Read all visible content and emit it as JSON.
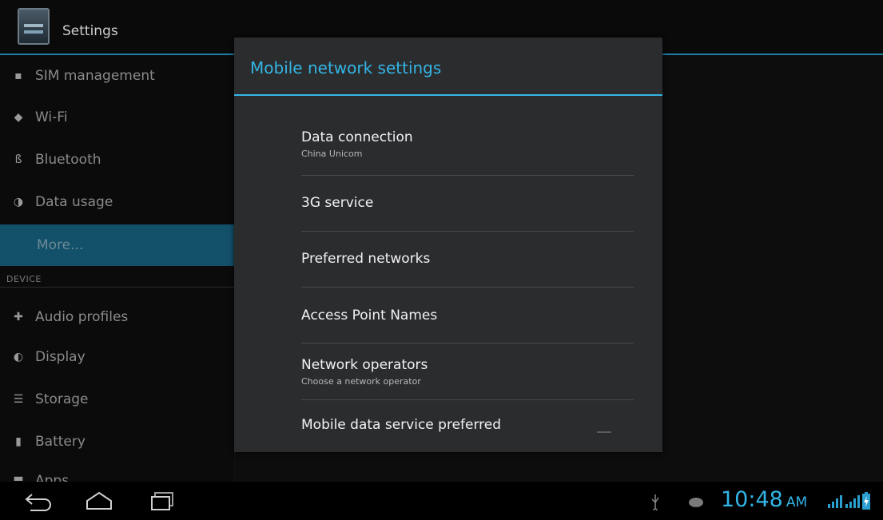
{
  "app": {
    "title": "Settings"
  },
  "sidebar": {
    "items": [
      {
        "label": "SIM management",
        "icon": "sim-icon"
      },
      {
        "label": "Wi-Fi",
        "icon": "wifi-icon"
      },
      {
        "label": "Bluetooth",
        "icon": "bluetooth-icon"
      },
      {
        "label": "Data usage",
        "icon": "data-usage-icon"
      },
      {
        "label": "More...",
        "icon": ""
      }
    ],
    "section_device": "DEVICE",
    "device_items": [
      {
        "label": "Audio profiles",
        "icon": "audio-profiles-icon"
      },
      {
        "label": "Display",
        "icon": "display-icon"
      },
      {
        "label": "Storage",
        "icon": "storage-icon"
      },
      {
        "label": "Battery",
        "icon": "battery-icon"
      },
      {
        "label": "Apps",
        "icon": "apps-icon"
      }
    ]
  },
  "dialog": {
    "title": "Mobile network settings",
    "items": [
      {
        "title": "Data connection",
        "summary": "China Unicom"
      },
      {
        "title": "3G service",
        "summary": ""
      },
      {
        "title": "Preferred networks",
        "summary": ""
      },
      {
        "title": "Access Point Names",
        "summary": ""
      },
      {
        "title": "Network operators",
        "summary": "Choose a network operator"
      },
      {
        "title": "Mobile data service preferred",
        "summary": ""
      }
    ]
  },
  "statusbar": {
    "time": "10:48",
    "ampm": "AM"
  },
  "colors": {
    "accent": "#33b5e5",
    "selected": "#13506a"
  }
}
